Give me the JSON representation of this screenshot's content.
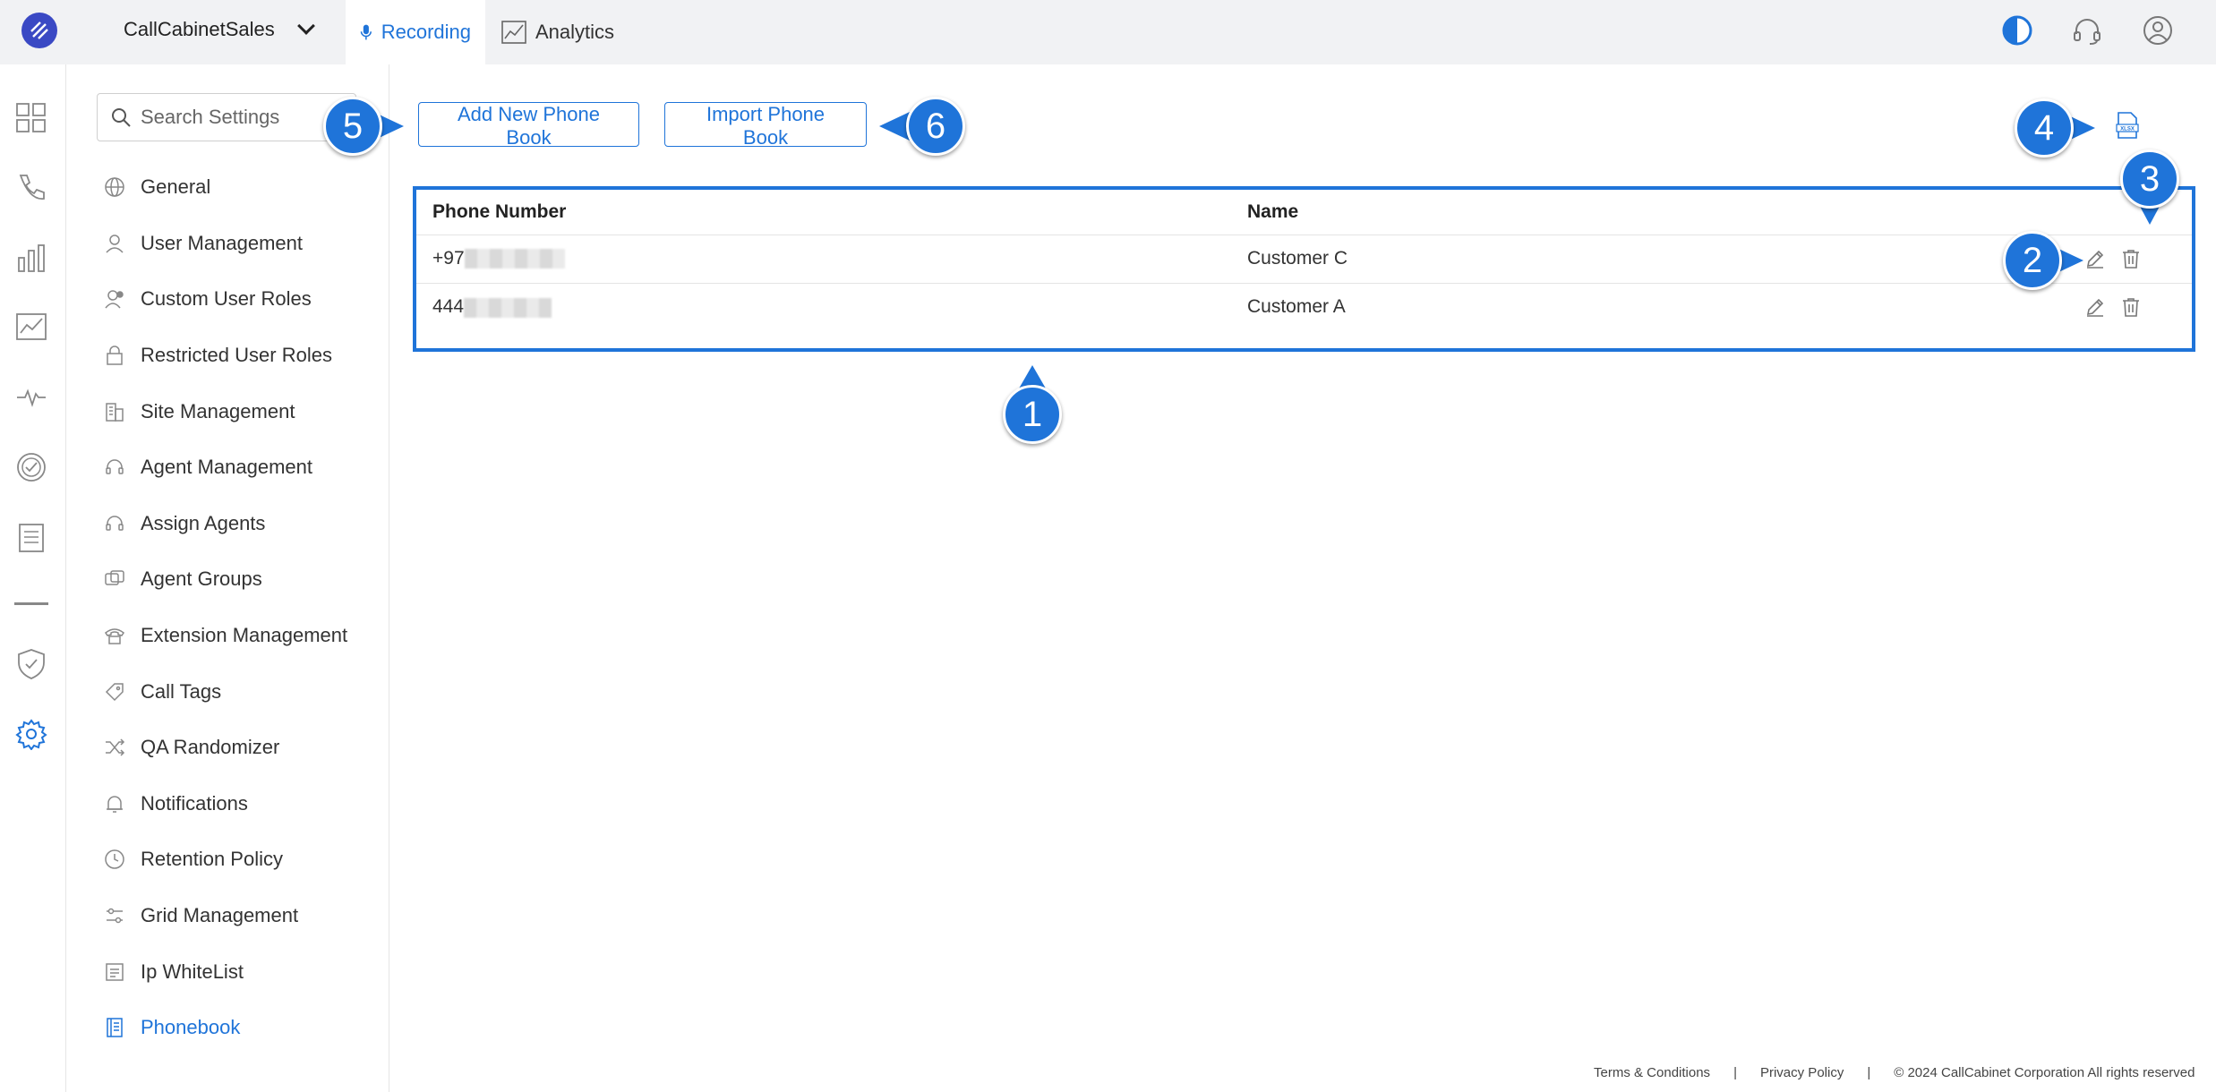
{
  "topbar": {
    "org_name": "CallCabinetSales",
    "tabs": [
      {
        "label": "Recording",
        "active": true
      },
      {
        "label": "Analytics",
        "active": false
      }
    ]
  },
  "settings": {
    "search_placeholder": "Search Settings",
    "menu": [
      {
        "label": "General",
        "icon": "globe-icon"
      },
      {
        "label": "User Management",
        "icon": "user-icon"
      },
      {
        "label": "Custom User Roles",
        "icon": "user-role-icon"
      },
      {
        "label": "Restricted User Roles",
        "icon": "lock-icon"
      },
      {
        "label": "Site Management",
        "icon": "building-icon"
      },
      {
        "label": "Agent Management",
        "icon": "headset-icon"
      },
      {
        "label": "Assign Agents",
        "icon": "headset-icon"
      },
      {
        "label": "Agent Groups",
        "icon": "group-icon"
      },
      {
        "label": "Extension Management",
        "icon": "phone-icon"
      },
      {
        "label": "Call Tags",
        "icon": "tag-icon"
      },
      {
        "label": "QA Randomizer",
        "icon": "shuffle-icon"
      },
      {
        "label": "Notifications",
        "icon": "bell-icon"
      },
      {
        "label": "Retention Policy",
        "icon": "clock-icon"
      },
      {
        "label": "Grid Management",
        "icon": "sliders-icon"
      },
      {
        "label": "Ip WhiteList",
        "icon": "list-icon"
      },
      {
        "label": "Phonebook",
        "icon": "phonebook-icon",
        "active": true
      }
    ]
  },
  "main": {
    "add_button": "Add New Phone Book",
    "import_button": "Import Phone Book",
    "table": {
      "headers": [
        "Phone Number",
        "Name"
      ],
      "rows": [
        {
          "phone_prefix": "+97",
          "name": "Customer C"
        },
        {
          "phone_prefix": "444",
          "name": "Customer A"
        }
      ]
    },
    "callouts": [
      "1",
      "2",
      "3",
      "4",
      "5",
      "6"
    ]
  },
  "footer": {
    "terms": "Terms & Conditions",
    "sep1": "|",
    "privacy": "Privacy Policy",
    "sep2": "|",
    "copyright": "© 2024 CallCabinet Corporation All rights reserved"
  },
  "colors": {
    "accent": "#1f74d9",
    "logo": "#3a49c4"
  }
}
